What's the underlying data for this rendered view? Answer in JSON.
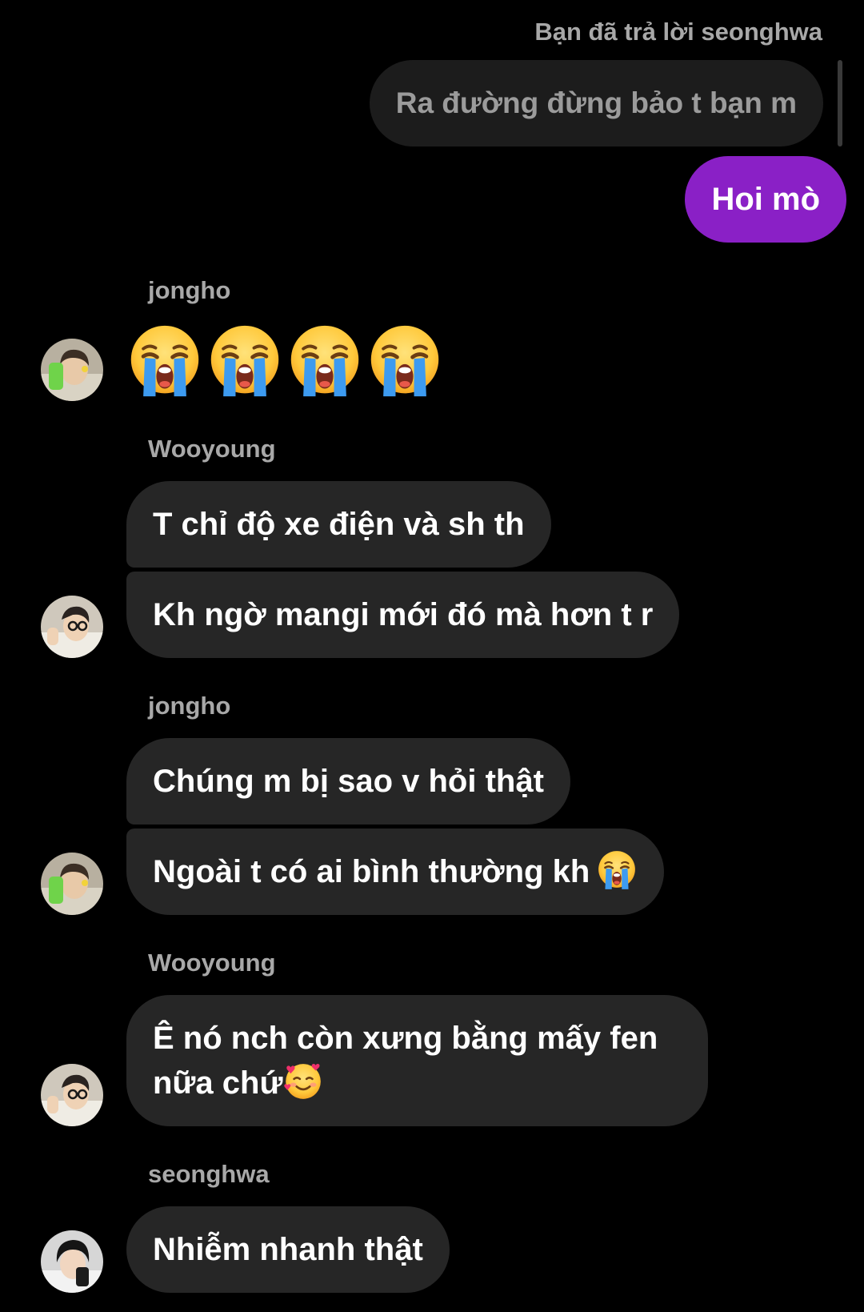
{
  "reply_note": "Bạn đã trả lời seonghwa",
  "quoted_message": "Ra đường đừng bảo t bạn m",
  "sent_message": "Hoi mò",
  "colors": {
    "background": "#000000",
    "received_bubble": "#262626",
    "quoted_bubble": "#1c1c1c",
    "sent_bubble": "#8a20c6",
    "muted_text": "#a8a8a8"
  },
  "groups": [
    {
      "sender": "jongho",
      "emoji_message": [
        "loudly-crying-face",
        "loudly-crying-face",
        "loudly-crying-face",
        "loudly-crying-face"
      ]
    },
    {
      "sender": "Wooyoung",
      "messages": [
        "T chỉ độ xe điện và sh th",
        "Kh ngờ mangi mới đó mà hơn t r"
      ]
    },
    {
      "sender": "jongho",
      "messages": [
        "Chúng m bị sao v hỏi thật",
        "Ngoài t có ai bình thường kh"
      ],
      "trailing_emoji": "loudly-crying-face"
    },
    {
      "sender": "Wooyoung",
      "messages": [
        "Ê nó nch còn xưng bằng mấy fen nữa chứ"
      ],
      "trailing_emoji": "smiling-face-with-hearts"
    },
    {
      "sender": "seonghwa",
      "messages": [
        "Nhiễm nhanh thật"
      ]
    }
  ]
}
